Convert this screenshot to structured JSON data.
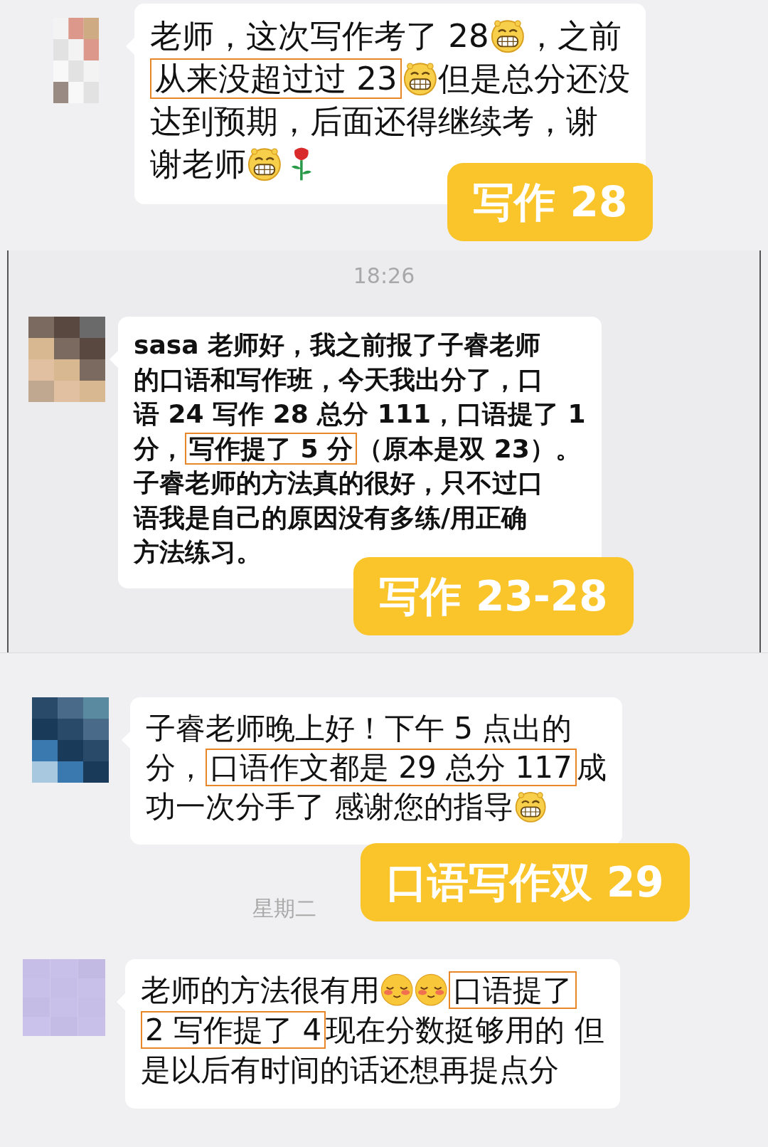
{
  "panels": [
    {
      "message": {
        "lines": [
          [
            {
              "kind": "text",
              "text": "老师，这次写作考了 28"
            },
            {
              "kind": "grin"
            },
            {
              "kind": "text",
              "text": "，之前"
            }
          ],
          [
            {
              "kind": "mark",
              "text": "从来没超过过 23"
            },
            {
              "kind": "grin"
            },
            {
              "kind": "text",
              "text": "但是总分还没"
            }
          ],
          [
            {
              "kind": "text",
              "text": "达到预期，后面还得继续考，谢"
            }
          ],
          [
            {
              "kind": "text",
              "text": "谢老师"
            },
            {
              "kind": "grin"
            },
            {
              "kind": "rose"
            }
          ]
        ]
      },
      "sticker": "写作 28"
    },
    {
      "timestamp": "18:26",
      "message": {
        "lines": [
          [
            {
              "kind": "text",
              "text": "sasa 老师好，我之前报了子睿老师"
            }
          ],
          [
            {
              "kind": "text",
              "text": "的口语和写作班，今天我出分了，口"
            }
          ],
          [
            {
              "kind": "text",
              "text": "语 24 写作 28 总分 111，口语提了 1"
            }
          ],
          [
            {
              "kind": "text",
              "text": "分，"
            },
            {
              "kind": "mark",
              "text": "写作提了 5 分"
            },
            {
              "kind": "text",
              "text": "（原本是双 23）。"
            }
          ],
          [
            {
              "kind": "text",
              "text": "子睿老师的方法真的很好，只不过口"
            }
          ],
          [
            {
              "kind": "text",
              "text": "语我是自己的原因没有多练/用正确"
            }
          ],
          [
            {
              "kind": "text",
              "text": "方法练习。"
            }
          ]
        ]
      },
      "sticker": "写作 23-28"
    },
    {
      "message": {
        "lines": [
          [
            {
              "kind": "text",
              "text": "子睿老师晚上好！下午 5 点出的"
            }
          ],
          [
            {
              "kind": "text",
              "text": "分，"
            },
            {
              "kind": "mark",
              "text": "口语作文都是 29 总分 117"
            },
            {
              "kind": "text",
              "text": "成"
            }
          ],
          [
            {
              "kind": "text",
              "text": "功一次分手了 感谢您的指导"
            },
            {
              "kind": "grin"
            }
          ]
        ]
      },
      "sticker": "口语写作双 29"
    },
    {
      "timestamp": "星期二",
      "message": {
        "lines": [
          [
            {
              "kind": "text",
              "text": "老师的方法很有用"
            },
            {
              "kind": "blush"
            },
            {
              "kind": "blush"
            },
            {
              "kind": "mark",
              "text": "口语提了"
            }
          ],
          [
            {
              "kind": "mark",
              "text": "2 写作提了 4"
            },
            {
              "kind": "text",
              "text": "现在分数挺够用的 但"
            }
          ],
          [
            {
              "kind": "text",
              "text": "是以后有时间的话还想再提点分"
            }
          ]
        ]
      }
    }
  ]
}
